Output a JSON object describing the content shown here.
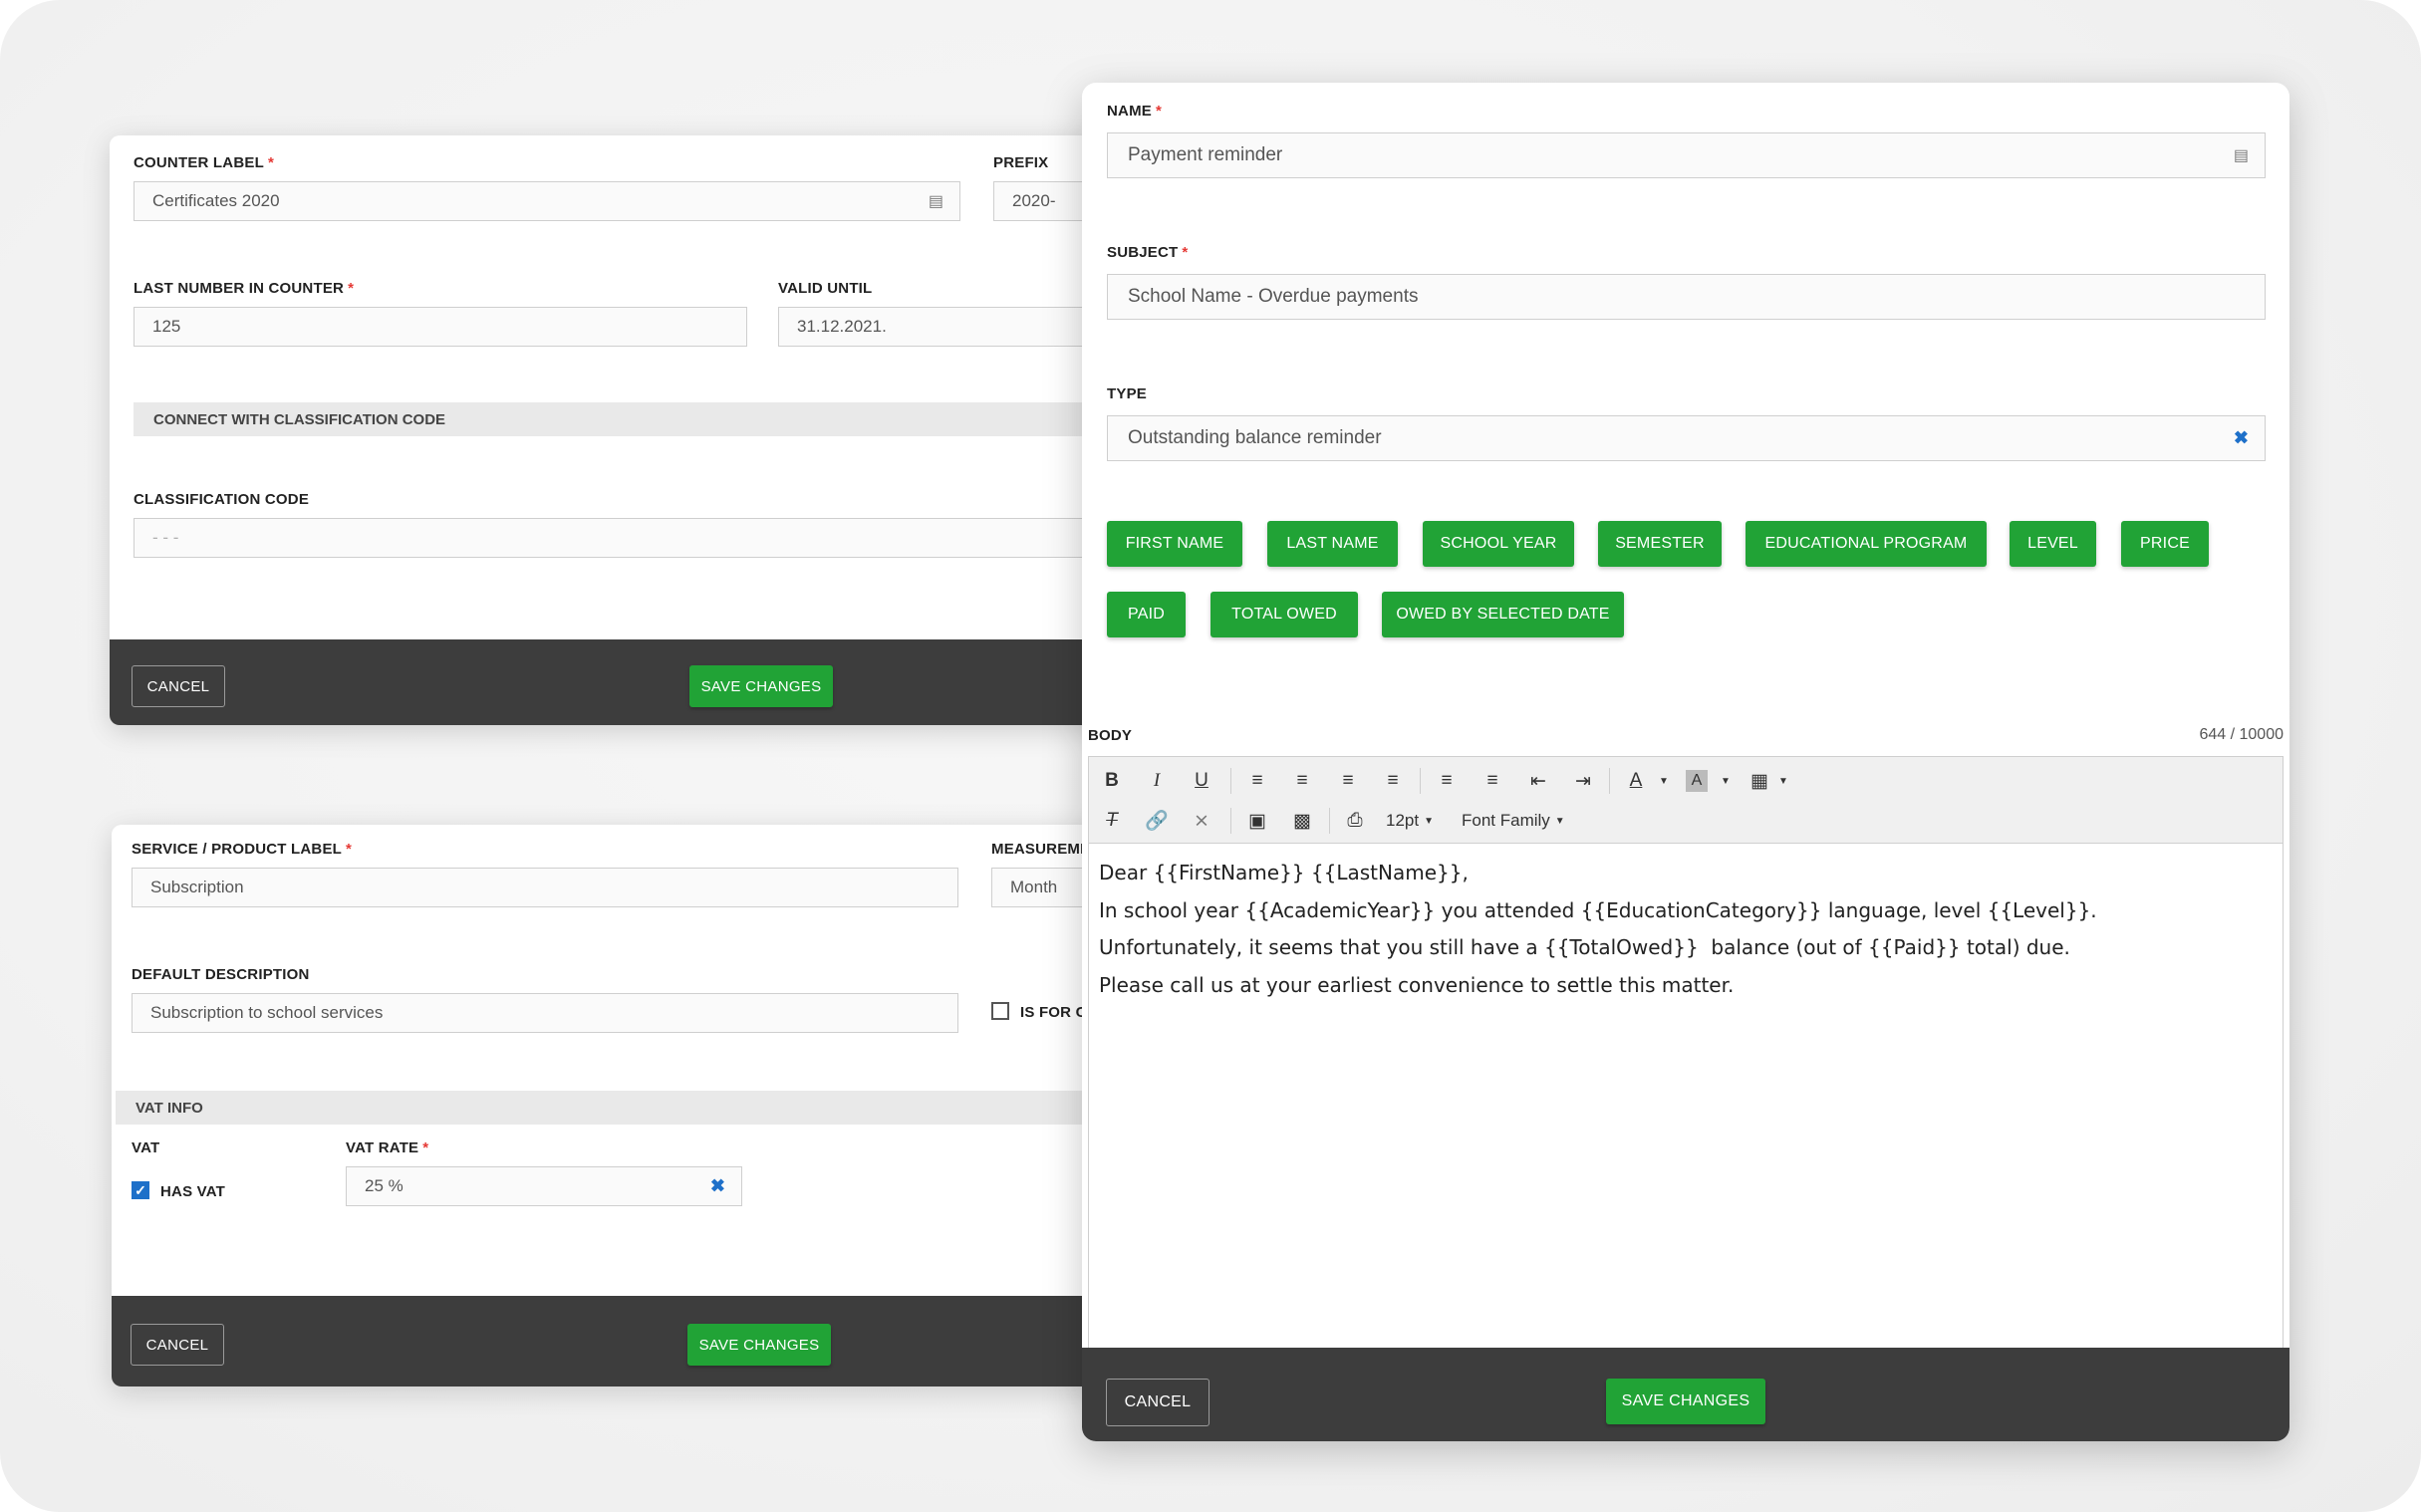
{
  "counter_form": {
    "counter_label": "COUNTER LABEL",
    "counter_value": "Certificates 2020",
    "prefix_label": "PREFIX",
    "prefix_value": "2020-",
    "last_number_label": "LAST NUMBER IN COUNTER",
    "last_number_value": "125",
    "valid_until_label": "VALID UNTIL",
    "valid_until_value": "31.12.2021.",
    "section": "CONNECT WITH CLASSIFICATION CODE",
    "classification_label": "CLASSIFICATION CODE",
    "classification_placeholder": "- - -",
    "cancel": "CANCEL",
    "save": "SAVE CHANGES"
  },
  "product_form": {
    "product_label": "SERVICE / PRODUCT LABEL",
    "product_value": "Subscription",
    "measurement_label": "MEASUREME",
    "measurement_value": "Month",
    "description_label": "DEFAULT DESCRIPTION",
    "description_value": "Subscription to school services",
    "is_for_label": "IS FOR C",
    "section": "VAT INFO",
    "vat_label": "VAT",
    "has_vat": "HAS VAT",
    "vat_rate_label": "VAT RATE",
    "vat_rate_value": "25 %",
    "cancel": "CANCEL",
    "save": "SAVE CHANGES"
  },
  "template_form": {
    "name_label": "NAME",
    "name_value": "Payment reminder",
    "subject_label": "SUBJECT",
    "subject_value": "School Name - Overdue payments",
    "type_label": "TYPE",
    "type_value": "Outstanding balance reminder",
    "placeholders": [
      "FIRST NAME",
      "LAST NAME",
      "SCHOOL YEAR",
      "SEMESTER",
      "EDUCATIONAL PROGRAM",
      "LEVEL",
      "PRICE",
      "PAID",
      "TOTAL OWED",
      "OWED BY SELECTED DATE"
    ],
    "body_label": "BODY",
    "char_count": "644 / 10000",
    "font_size": "12pt",
    "font_family": "Font Family",
    "body_lines": [
      "Dear {{FirstName}} {{LastName}},",
      "In school year {{AcademicYear}} you attended {{EducationCategory}} language, level {{Level}}.",
      "Unfortunately, it seems that you still have a {{TotalOwed}}  balance (out of {{Paid}} total) due.",
      "Please call us at your earliest convenience to settle this matter."
    ],
    "cancel": "CANCEL",
    "save": "SAVE CHANGES"
  },
  "colors": {
    "accent_green": "#21a336",
    "footer": "#3d3d3d",
    "required": "#e53935",
    "link_blue": "#1e70c9"
  }
}
